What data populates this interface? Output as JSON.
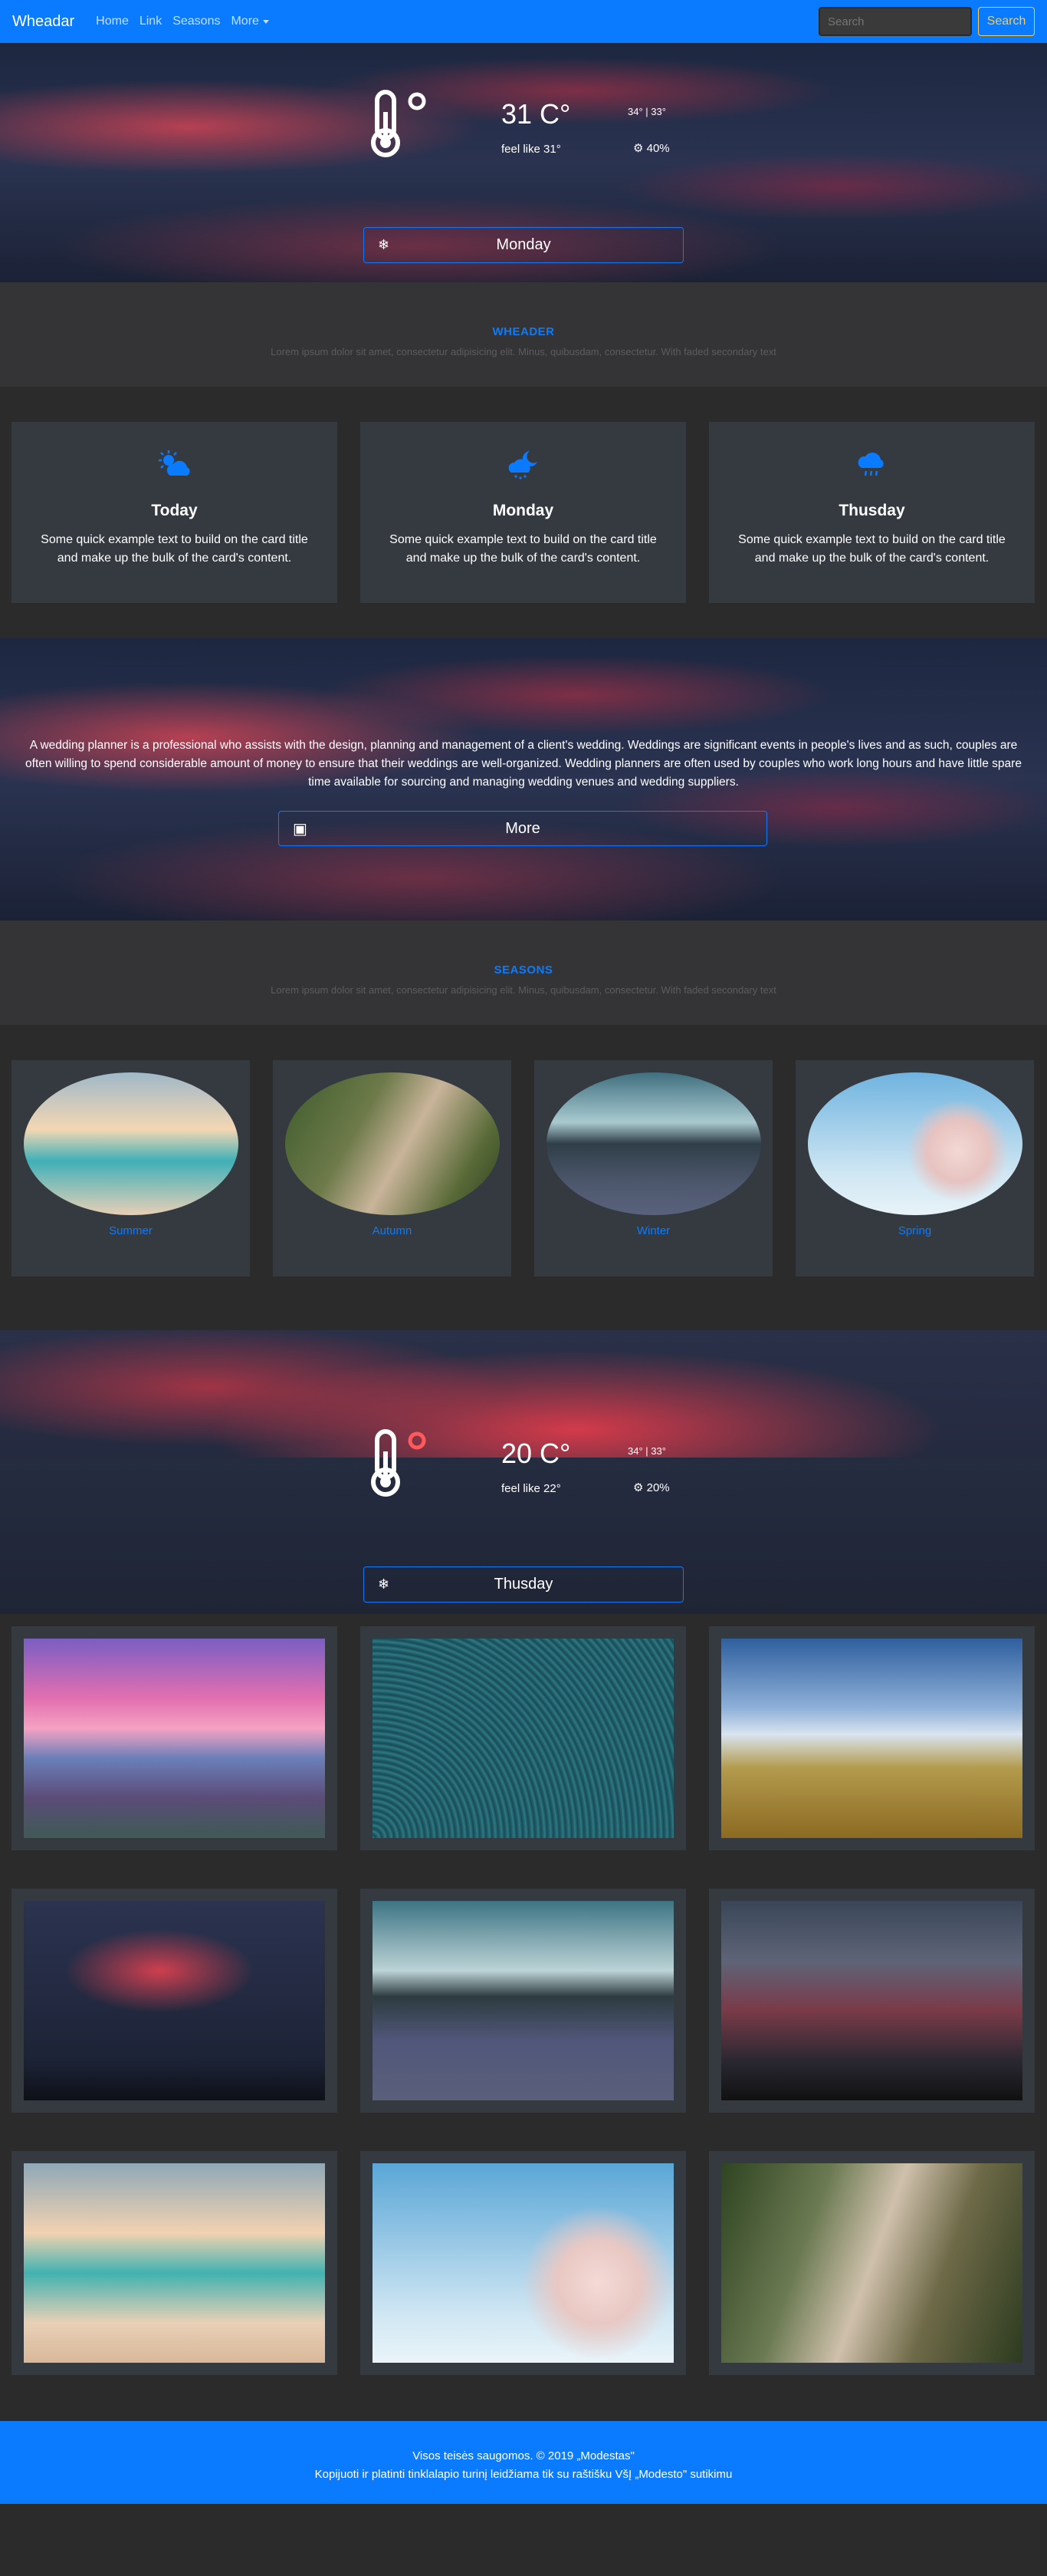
{
  "navbar": {
    "brand": "Wheadar",
    "links": [
      "Home",
      "Link",
      "Seasons"
    ],
    "more_label": "More",
    "search_placeholder": "Search",
    "search_button": "Search"
  },
  "weather1": {
    "temp": "31 C°",
    "feels": "feel like 31°",
    "minmax": "34°  |  33°",
    "humidity": "40%",
    "day": "Monday"
  },
  "header_section": {
    "title": "WHEADER",
    "subtitle": "Lorem ipsum dolor sit amet, consectetur adipisicing elit. Minus, quibusdam, consectetur. With faded secondary text"
  },
  "forecast_cards": [
    {
      "title": "Today",
      "text": "Some quick example text to build on the card title and make up the bulk of the card's content.",
      "icon": "sun-cloud-icon"
    },
    {
      "title": "Monday",
      "text": "Some quick example text to build on the card title and make up the bulk of the card's content.",
      "icon": "moon-cloud-icon"
    },
    {
      "title": "Thusday",
      "text": "Some quick example text to build on the card title and make up the bulk of the card's content.",
      "icon": "rain-cloud-icon"
    }
  ],
  "wedding": {
    "text": "A wedding planner is a professional who assists with the design, planning and management of a client's wedding. Weddings are significant events in people's lives and as such, couples are often willing to spend considerable amount of money to ensure that their weddings are well-organized. Wedding planners are often used by couples who work long hours and have little spare time available for sourcing and managing wedding venues and wedding suppliers.",
    "button": "More"
  },
  "seasons_section": {
    "title": "SEASONS",
    "subtitle": "Lorem ipsum dolor sit amet, consectetur adipisicing elit. Minus, quibusdam, consectetur. With faded secondary text"
  },
  "seasons": [
    "Summer",
    "Autumn",
    "Winter",
    "Spring"
  ],
  "weather2": {
    "temp": "20 C°",
    "feels": "feel like 22°",
    "minmax": "34°  |  33°",
    "humidity": "20%",
    "day": "Thusday"
  },
  "gallery_count": 9,
  "footer": {
    "line1": "Visos teisės saugomos. © 2019 „Modestas\"",
    "line2": "Kopijuoti ir platinti tinklalapio turinį leidžiama tik su raštišku VšĮ „Modesto\" sutikimu"
  },
  "colors": {
    "accent": "#0a7bff",
    "card": "#343a40",
    "band": "#343436",
    "page": "#2b2b2b"
  }
}
